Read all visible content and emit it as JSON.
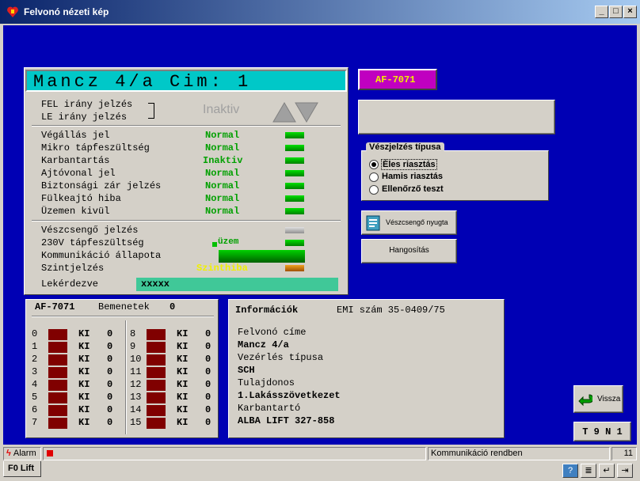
{
  "window": {
    "title": "Felvonó nézeti kép",
    "btn_min": "_",
    "btn_max": "□",
    "btn_close": "×"
  },
  "main": {
    "title": "Mancz 4/a Cim: 1",
    "fel": "FEL irány jelzés",
    "le": "LE  irány jelzés",
    "direction_status": "Inaktiv",
    "signals": [
      {
        "label": "Végállás jel",
        "value": "Normal"
      },
      {
        "label": "Mikro tápfeszültség",
        "value": "Normal"
      },
      {
        "label": "Karbantartás",
        "value": "Inaktiv"
      },
      {
        "label": "Ajtóvonal jel",
        "value": "Normal"
      },
      {
        "label": "Biztonsági zár jelzés",
        "value": "Normal"
      },
      {
        "label": "Fülkeajtó hiba",
        "value": "Normal"
      },
      {
        "label": "Üzemen kivül",
        "value": "Normal"
      }
    ],
    "vesz_label": "Vészcsengő jelzés",
    "v230_label": "230V tápfeszültség",
    "v230_value": "üzem",
    "komm_label": "Kommunikáció állapota",
    "szint_label": "Szintjelzés",
    "szint_value": "Szinthiba",
    "lekerdezve_label": "Lekérdezve",
    "lekerdezve_value": "xxxxx"
  },
  "af_badge": "AF-7071",
  "vesz_group": {
    "title": "Vészjelzés típusa",
    "options": [
      "Éles riasztás",
      "Hamis riasztás",
      "Ellenőrző teszt"
    ],
    "selected": 0
  },
  "buttons": {
    "veszcsengo": "Vészcsengő nyugta",
    "hangositas": "Hangosítás",
    "vissza": "Vissza",
    "t9n1": "T 9 N 1"
  },
  "inputs": {
    "title": "AF-7071",
    "bemenetek_label": "Bemenetek",
    "bemenetek_value": "0",
    "left": [
      {
        "n": "0",
        "ki": "KI",
        "v": "0"
      },
      {
        "n": "1",
        "ki": "KI",
        "v": "0"
      },
      {
        "n": "2",
        "ki": "KI",
        "v": "0"
      },
      {
        "n": "3",
        "ki": "KI",
        "v": "0"
      },
      {
        "n": "4",
        "ki": "KI",
        "v": "0"
      },
      {
        "n": "5",
        "ki": "KI",
        "v": "0"
      },
      {
        "n": "6",
        "ki": "KI",
        "v": "0"
      },
      {
        "n": "7",
        "ki": "KI",
        "v": "0"
      }
    ],
    "right": [
      {
        "n": "8",
        "ki": "KI",
        "v": "0"
      },
      {
        "n": "9",
        "ki": "KI",
        "v": "0"
      },
      {
        "n": "10",
        "ki": "KI",
        "v": "0"
      },
      {
        "n": "11",
        "ki": "KI",
        "v": "0"
      },
      {
        "n": "12",
        "ki": "KI",
        "v": "0"
      },
      {
        "n": "13",
        "ki": "KI",
        "v": "0"
      },
      {
        "n": "14",
        "ki": "KI",
        "v": "0"
      },
      {
        "n": "15",
        "ki": "KI",
        "v": "0"
      }
    ]
  },
  "info": {
    "title": "Információk",
    "emi": "EMI szám 35-0409/75",
    "lines": [
      "Felvonó címe",
      "Mancz 4/a",
      "Vezérlés típusa",
      "SCH",
      "Tulajdonos",
      "1.Lakásszövetkezet",
      "Karbantartó",
      "ALBA LIFT 327-858"
    ]
  },
  "statusbar": {
    "alarm": "Alarm",
    "komm": "Kommunikáció rendben",
    "count": "11",
    "tab": "F0 Lift"
  },
  "colors": {
    "background": "#0000b4",
    "ok": "#00a000",
    "warn": "#f0f000",
    "badge": "#c000c0"
  }
}
